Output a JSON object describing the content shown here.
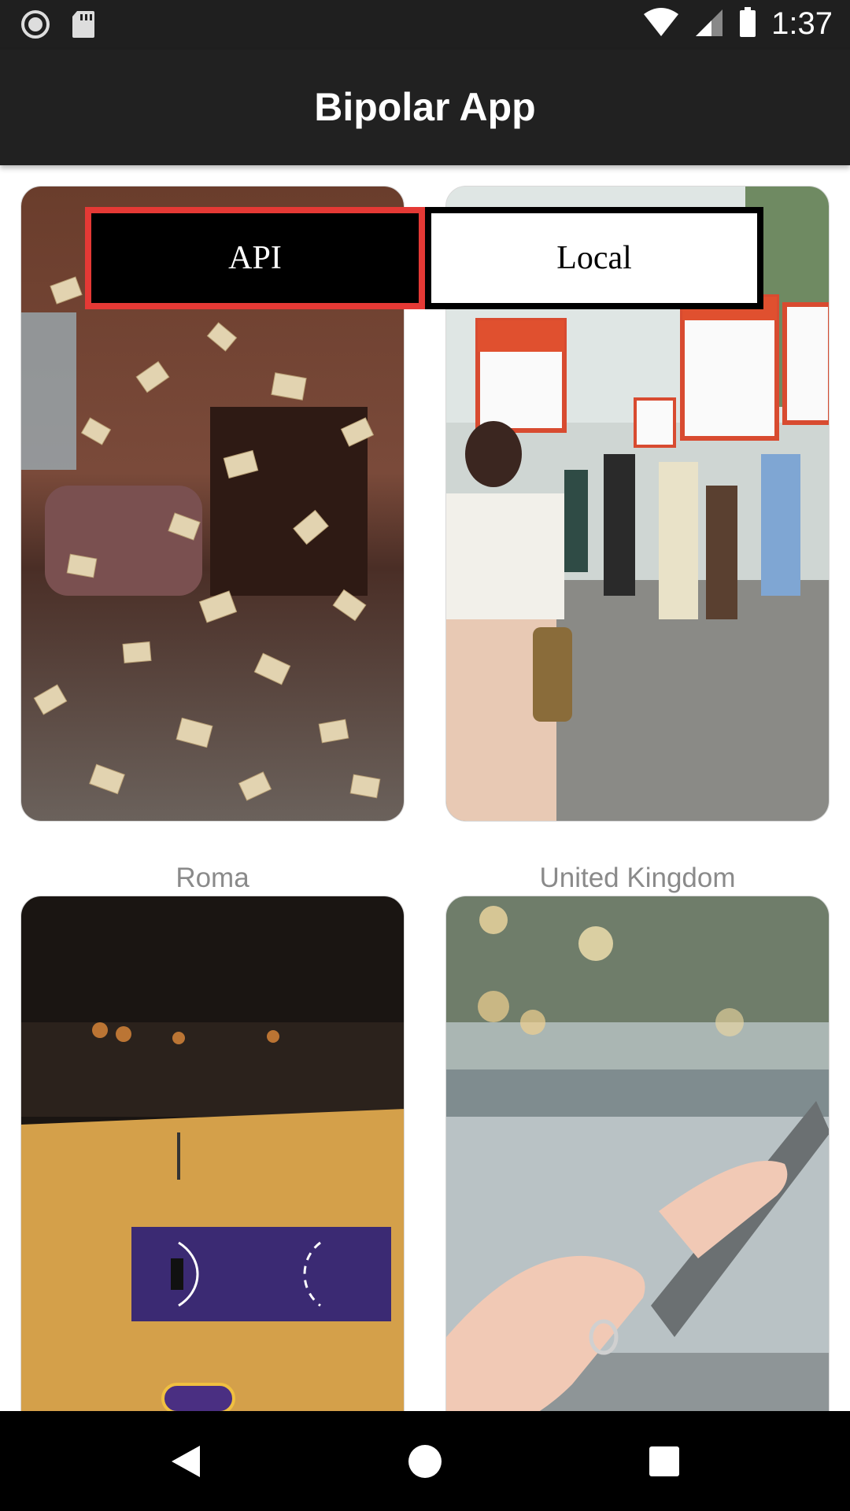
{
  "status_bar": {
    "time": "1:37",
    "icons": [
      "record-icon",
      "sd-card-icon",
      "wifi-icon",
      "cell-signal-icon",
      "battery-icon"
    ]
  },
  "app_bar": {
    "title": "Bipolar App"
  },
  "toggle": {
    "api_label": "API",
    "local_label": "Local",
    "selected": "API",
    "highlight_color": "#e53935"
  },
  "cards": [
    {
      "caption": "Roma",
      "image": "flying-letters-room-photo"
    },
    {
      "caption": "United Kingdom",
      "image": "civil-rights-march-photo"
    },
    {
      "caption": "",
      "image": "basketball-court-photo"
    },
    {
      "caption": "",
      "image": "hands-holding-phone-photo"
    }
  ],
  "nav_bar": {
    "icons": [
      "back-icon",
      "home-icon",
      "recents-icon"
    ]
  }
}
